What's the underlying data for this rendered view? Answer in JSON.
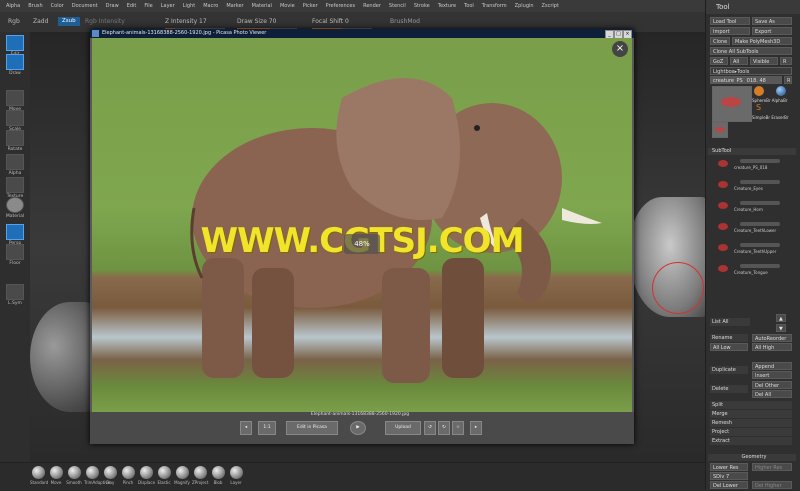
{
  "menu": [
    "Alpha",
    "Brush",
    "Color",
    "Document",
    "Draw",
    "Edit",
    "File",
    "Layer",
    "Light",
    "Macro",
    "Marker",
    "Material",
    "Movie",
    "Picker",
    "Preferences",
    "Render",
    "Stencil",
    "Stroke",
    "Texture",
    "Tool",
    "Transform",
    "Zplugin",
    "Zscript"
  ],
  "toolbar": {
    "rgb": "Rgb",
    "zadd": "Zadd",
    "zsub": "Zsub",
    "rgb_intensity": "Rgb Intensity",
    "z_intensity": "Z Intensity 17",
    "draw_size": "Draw Size 70",
    "focal_shift": "Focal Shift 0",
    "brushmod": "BrushMod",
    "z_intensity_value": 17,
    "draw_size_fraction": 0.55,
    "focal_shift_fraction": 0.5
  },
  "left_tools": [
    "Edit",
    "Draw",
    "Move",
    "Scale",
    "Rotate",
    "Alpha",
    "Texture",
    "Material",
    "Persp",
    "Floor",
    "L.Sym"
  ],
  "viewer": {
    "title": "Elephant-animals-13168388-2560-1920.jpg - Picasa Photo Viewer",
    "watermark": "WWW.CGTSJ.COM",
    "zoom": "48%",
    "caption": "Elephant-animals-13168388-2560-1920.jpg",
    "edit_button": "Edit in Picasa",
    "upload_button": "Upload"
  },
  "brushes": [
    "Standard",
    "Move",
    "Smooth",
    "TrimAdaptive",
    "Clay",
    "Pinch",
    "Displace",
    "Elastic",
    "Magnify",
    "ZProject",
    "Blob",
    "Layer"
  ],
  "right_panel": {
    "title": "Tool",
    "load_tool": "Load Tool",
    "save_as": "Save As",
    "import": "Import",
    "export": "Export",
    "clone": "Clone",
    "make_polymesh": "Make PolyMesh3D",
    "clone_all": "Clone All SubTools",
    "goz": "GoZ",
    "all": "All",
    "visible": "Visible",
    "r": "R",
    "lightbox_tools": "Lightbox▸Tools",
    "current_tool": "creature_PS_ 018. 48",
    "thumbs": [
      "SphereBr AlphaBr",
      "SimpleBr EraserBr"
    ],
    "subtool_header": "SubTool",
    "subtools": [
      "creature_PS_018",
      "Creature_Eyes",
      "Creature_Horn",
      "Creature_TeethLower",
      "Creature_TeethUpper",
      "Creature_Tongue"
    ],
    "list_all": "List All",
    "rename": "Rename",
    "auto_reorder": "AutoReorder",
    "all_low": "All Low",
    "all_high": "All High",
    "duplicate": "Duplicate",
    "append": "Append",
    "insert": "Insert",
    "delete": "Delete",
    "del_other": "Del Other",
    "del_all": "Del All",
    "split": "Split",
    "merge": "Merge",
    "remesh": "Remesh",
    "project": "Project",
    "extract": "Extract",
    "geometry": "Geometry",
    "lower_res": "Lower Res",
    "higher_res": "Higher Res",
    "sdiv": "SDiv 7",
    "del_lower": "Del Lower",
    "del_higher": "Del Higher"
  }
}
